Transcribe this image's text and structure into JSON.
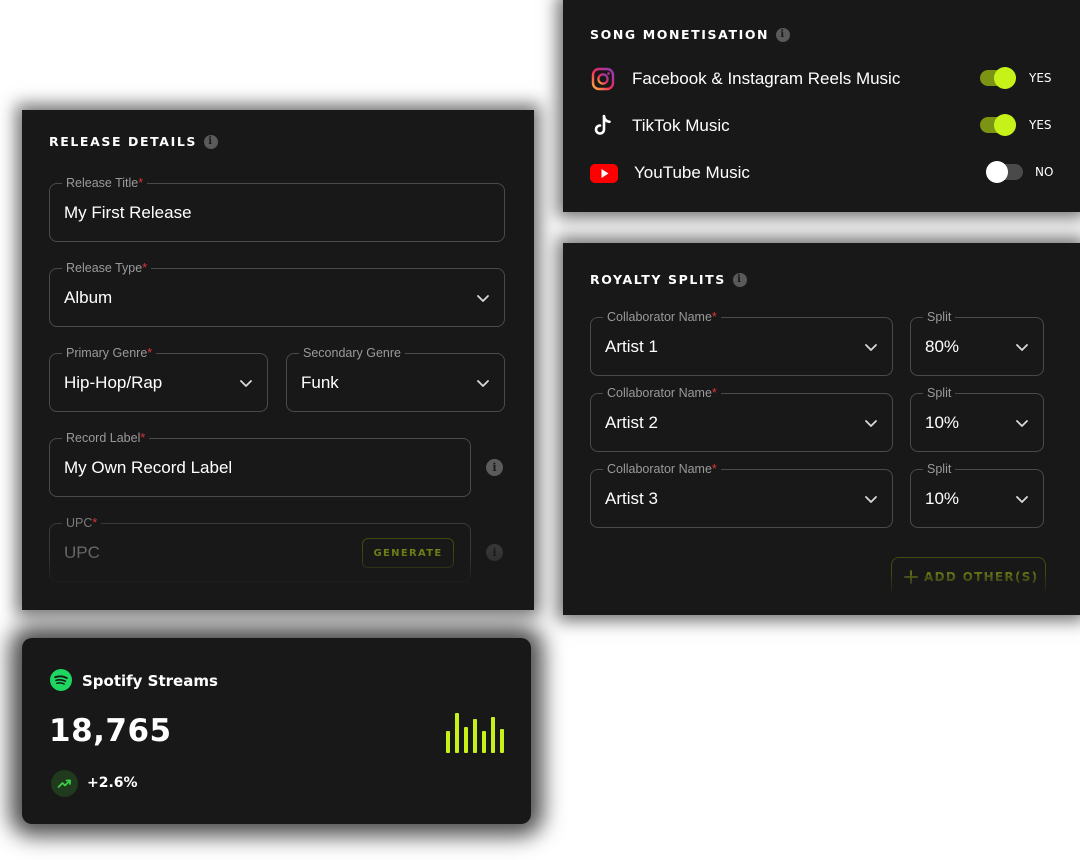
{
  "release": {
    "title": "RELEASE DETAILS",
    "fields": {
      "release_title": {
        "label": "Release Title",
        "value": "My First Release"
      },
      "release_type": {
        "label": "Release Type",
        "value": "Album"
      },
      "primary_genre": {
        "label": "Primary Genre",
        "value": "Hip-Hop/Rap"
      },
      "secondary_genre": {
        "label": "Secondary Genre",
        "value": "Funk"
      },
      "record_label": {
        "label": "Record Label",
        "value": "My Own Record Label"
      },
      "upc": {
        "label": "UPC",
        "placeholder": "UPC",
        "button": "GENERATE"
      }
    },
    "required_mark": "*",
    "info_glyph": "i"
  },
  "monetisation": {
    "title": "SONG MONETISATION",
    "items": [
      {
        "label": "Facebook & Instagram Reels Music",
        "state": "YES",
        "on": true,
        "icon": "instagram-icon"
      },
      {
        "label": "TikTok Music",
        "state": "YES",
        "on": true,
        "icon": "tiktok-icon"
      },
      {
        "label": "YouTube Music",
        "state": "NO",
        "on": false,
        "icon": "youtube-icon"
      }
    ]
  },
  "royalty": {
    "title": "ROYALTY SPLITS",
    "rows": [
      {
        "name_label": "Collaborator Name",
        "name": "Artist 1",
        "split_label": "Split",
        "split": "80%"
      },
      {
        "name_label": "Collaborator Name",
        "name": "Artist 2",
        "split_label": "Split",
        "split": "10%"
      },
      {
        "name_label": "Collaborator Name",
        "name": "Artist 3",
        "split_label": "Split",
        "split": "10%"
      }
    ],
    "add_button": "ADD OTHER(S)"
  },
  "spotify": {
    "title": "Spotify Streams",
    "count": "18,765",
    "change": "+2.6%",
    "bar_levels": [
      0.55,
      1.0,
      0.65,
      0.85,
      0.55,
      0.9,
      0.6
    ]
  },
  "colors": {
    "accent": "#c6f21a",
    "card": "#181818",
    "spotify": "#1ed760",
    "youtube": "#ff0000",
    "required": "#e0333b"
  }
}
